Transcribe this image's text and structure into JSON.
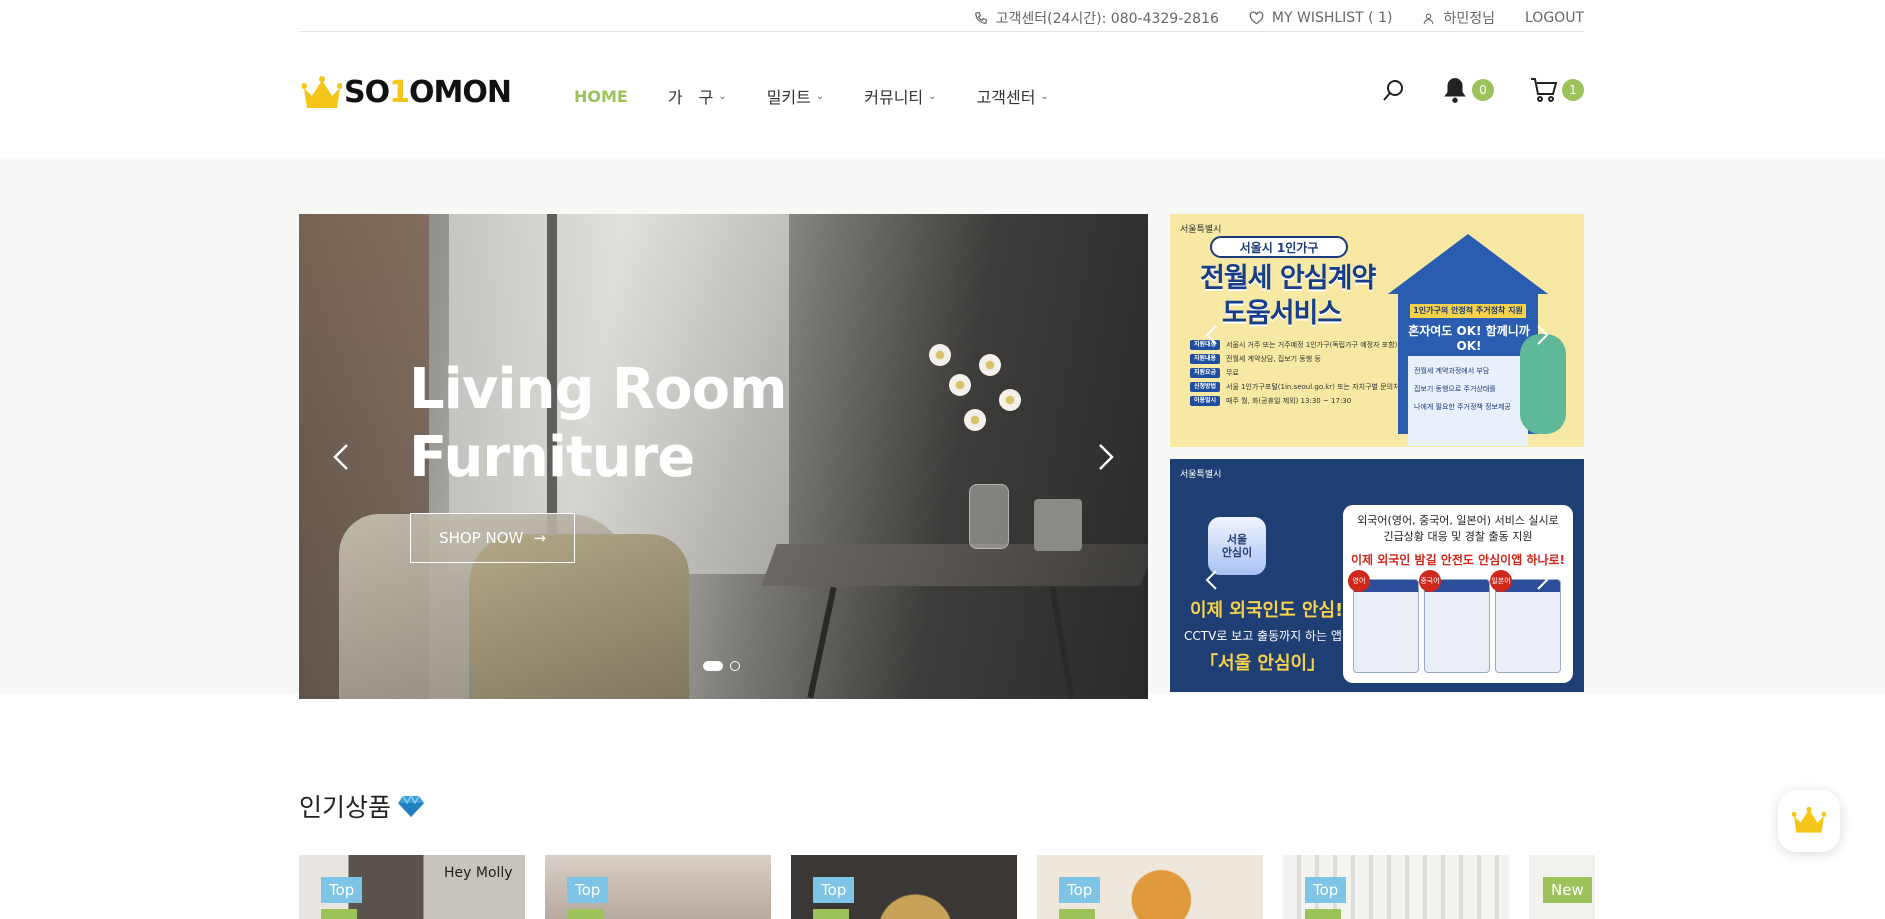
{
  "topbar": {
    "phone_label": "고객센터(24시간): 080-4329-2816",
    "wishlist_label": "MY WISHLIST ( 1)",
    "user_label": "하민정님",
    "logout_label": "LOGOUT"
  },
  "header": {
    "logo_pre": "SO",
    "logo_one": "1",
    "logo_post": "OMON",
    "nav": [
      {
        "label": "HOME"
      },
      {
        "label": "가　구"
      },
      {
        "label": "밀키트"
      },
      {
        "label": "커뮤니티"
      },
      {
        "label": "고객센터"
      }
    ],
    "notification_count": "0",
    "cart_count": "1"
  },
  "hero": {
    "title_line1": "Living Room",
    "title_line2": "Furniture",
    "button_label": "SHOP NOW"
  },
  "banner1": {
    "org": "서울특별시",
    "pill": "서울시 1인가구",
    "title1": "전월세 안심계약",
    "title2": "도움서비스",
    "rows": [
      {
        "k": "지원대상",
        "v": "서울시 거주 또는 거주예정 1인가구(독립가구 예정자 포함)"
      },
      {
        "k": "지원내용",
        "v": "전월세 계약상담, 집보기 동행 등"
      },
      {
        "k": "지원요금",
        "v": "무료"
      },
      {
        "k": "신청방법",
        "v": "서울 1인가구포털(1in.seoul.go.kr) 또는 자치구별 문의처"
      },
      {
        "k": "이용일시",
        "v": "매주 월, 화(공휴일 제외) 13:30 ~ 17:30"
      }
    ],
    "house_banner": "1인가구의 안정적 주거정착 지원",
    "house_ok": "혼자여도 OK! 함께니까 OK!",
    "house_list": [
      "전월세 계약과정에서 부담",
      "집보기 동행으로 주거상태를",
      "나에게 필요한 주거정책 정보제공"
    ]
  },
  "banner2": {
    "org": "서울특별시",
    "app_name": "서울\n안심이",
    "yellow1": "이제 외국인도 안심!",
    "white1": "CCTV로 보고 출동까지 하는 앱",
    "yellow2": "「서울 안심이」",
    "card_line1": "외국어(영어, 중국어, 일본어) 서비스 실시로",
    "card_line2": "긴급상황 대응 및 경찰 출동 지원",
    "card_red": "이제 외국인 밤길 안전도 안심이앱 하나로!",
    "langs": [
      "영어",
      "중국어",
      "일본어"
    ]
  },
  "section": {
    "title": "인기상품"
  },
  "products": [
    {
      "tag": "Top",
      "tag_type": "top",
      "img_text": "Hey Molly"
    },
    {
      "tag": "Top",
      "tag_type": "top",
      "img_text": ""
    },
    {
      "tag": "Top",
      "tag_type": "top",
      "img_text": ""
    },
    {
      "tag": "Top",
      "tag_type": "top",
      "img_text": ""
    },
    {
      "tag": "Top",
      "tag_type": "top",
      "img_text": ""
    },
    {
      "tag": "New",
      "tag_type": "new",
      "img_text": ""
    }
  ],
  "colors": {
    "accent": "#9bc35a",
    "tag_top": "#7ec4e6",
    "tag_new": "#9bc35a"
  },
  "icons": {
    "phone": "phone-icon",
    "wishlist": "heart-icon",
    "user": "user-icon",
    "search": "search-icon",
    "bell": "bell-icon",
    "cart": "cart-icon",
    "gem": "gem-icon",
    "crown": "crown-icon"
  }
}
